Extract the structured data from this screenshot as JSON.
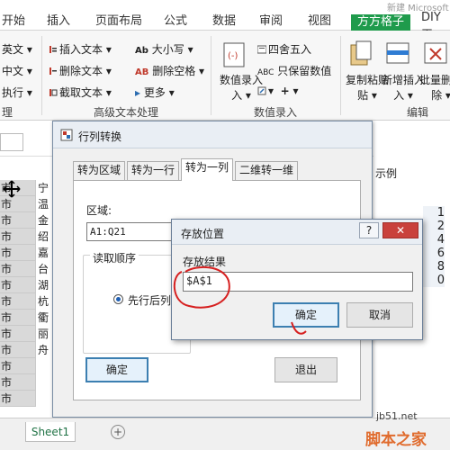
{
  "ribbon": {
    "tabs": [
      "开始",
      "插入",
      "页面布局",
      "公式",
      "数据",
      "审阅",
      "视图",
      "方方格子",
      "DIY工"
    ],
    "title_stub": "新建 Microsoft",
    "left_items": [
      "英文",
      "中文",
      "执行"
    ],
    "left_group_tail": "理",
    "text_items": [
      "插入文本",
      "删除文本",
      "截取文本"
    ],
    "text_items2": [
      "大小写",
      "删除空格",
      "更多"
    ],
    "text_group": "高级文本处理",
    "num_items": [
      "数值录入",
      "四舍五入",
      "只保留数值"
    ],
    "num_group": "数值录入",
    "edit_items": [
      "复制粘贴",
      "新增插入",
      "批量删除"
    ],
    "edit_group": "编辑"
  },
  "sheet": {
    "col1": [
      "市",
      "市",
      "市",
      "市",
      "市",
      "市",
      "市",
      "市",
      "市",
      "市",
      "市",
      "市",
      "市",
      "市"
    ],
    "col2": [
      "宁",
      "温",
      "金",
      "绍",
      "嘉",
      "台",
      "湖",
      "杭",
      "衢",
      "丽",
      "舟"
    ],
    "tab": "Sheet1",
    "add": "+"
  },
  "dialog": {
    "title": "行列转换",
    "tabs": [
      "转为区域",
      "转为一行",
      "转为一列",
      "二维转一维"
    ],
    "active_tab": 2,
    "range_label": "区域:",
    "range_value": "A1:Q21",
    "order_label": "读取顺序",
    "order_option": "先行后列",
    "ok": "确定",
    "exit": "退出",
    "example_label": "示例"
  },
  "sub_dialog": {
    "title": "存放位置",
    "help": "?",
    "close": "✕",
    "result_label": "存放结果",
    "result_value": "$A$1",
    "ok": "确定",
    "cancel": "取消"
  },
  "example_digits": [
    "1",
    "2",
    "4",
    "6",
    "8",
    "0"
  ],
  "watermark": {
    "url": "jb51.net",
    "name": "脚本之家"
  }
}
